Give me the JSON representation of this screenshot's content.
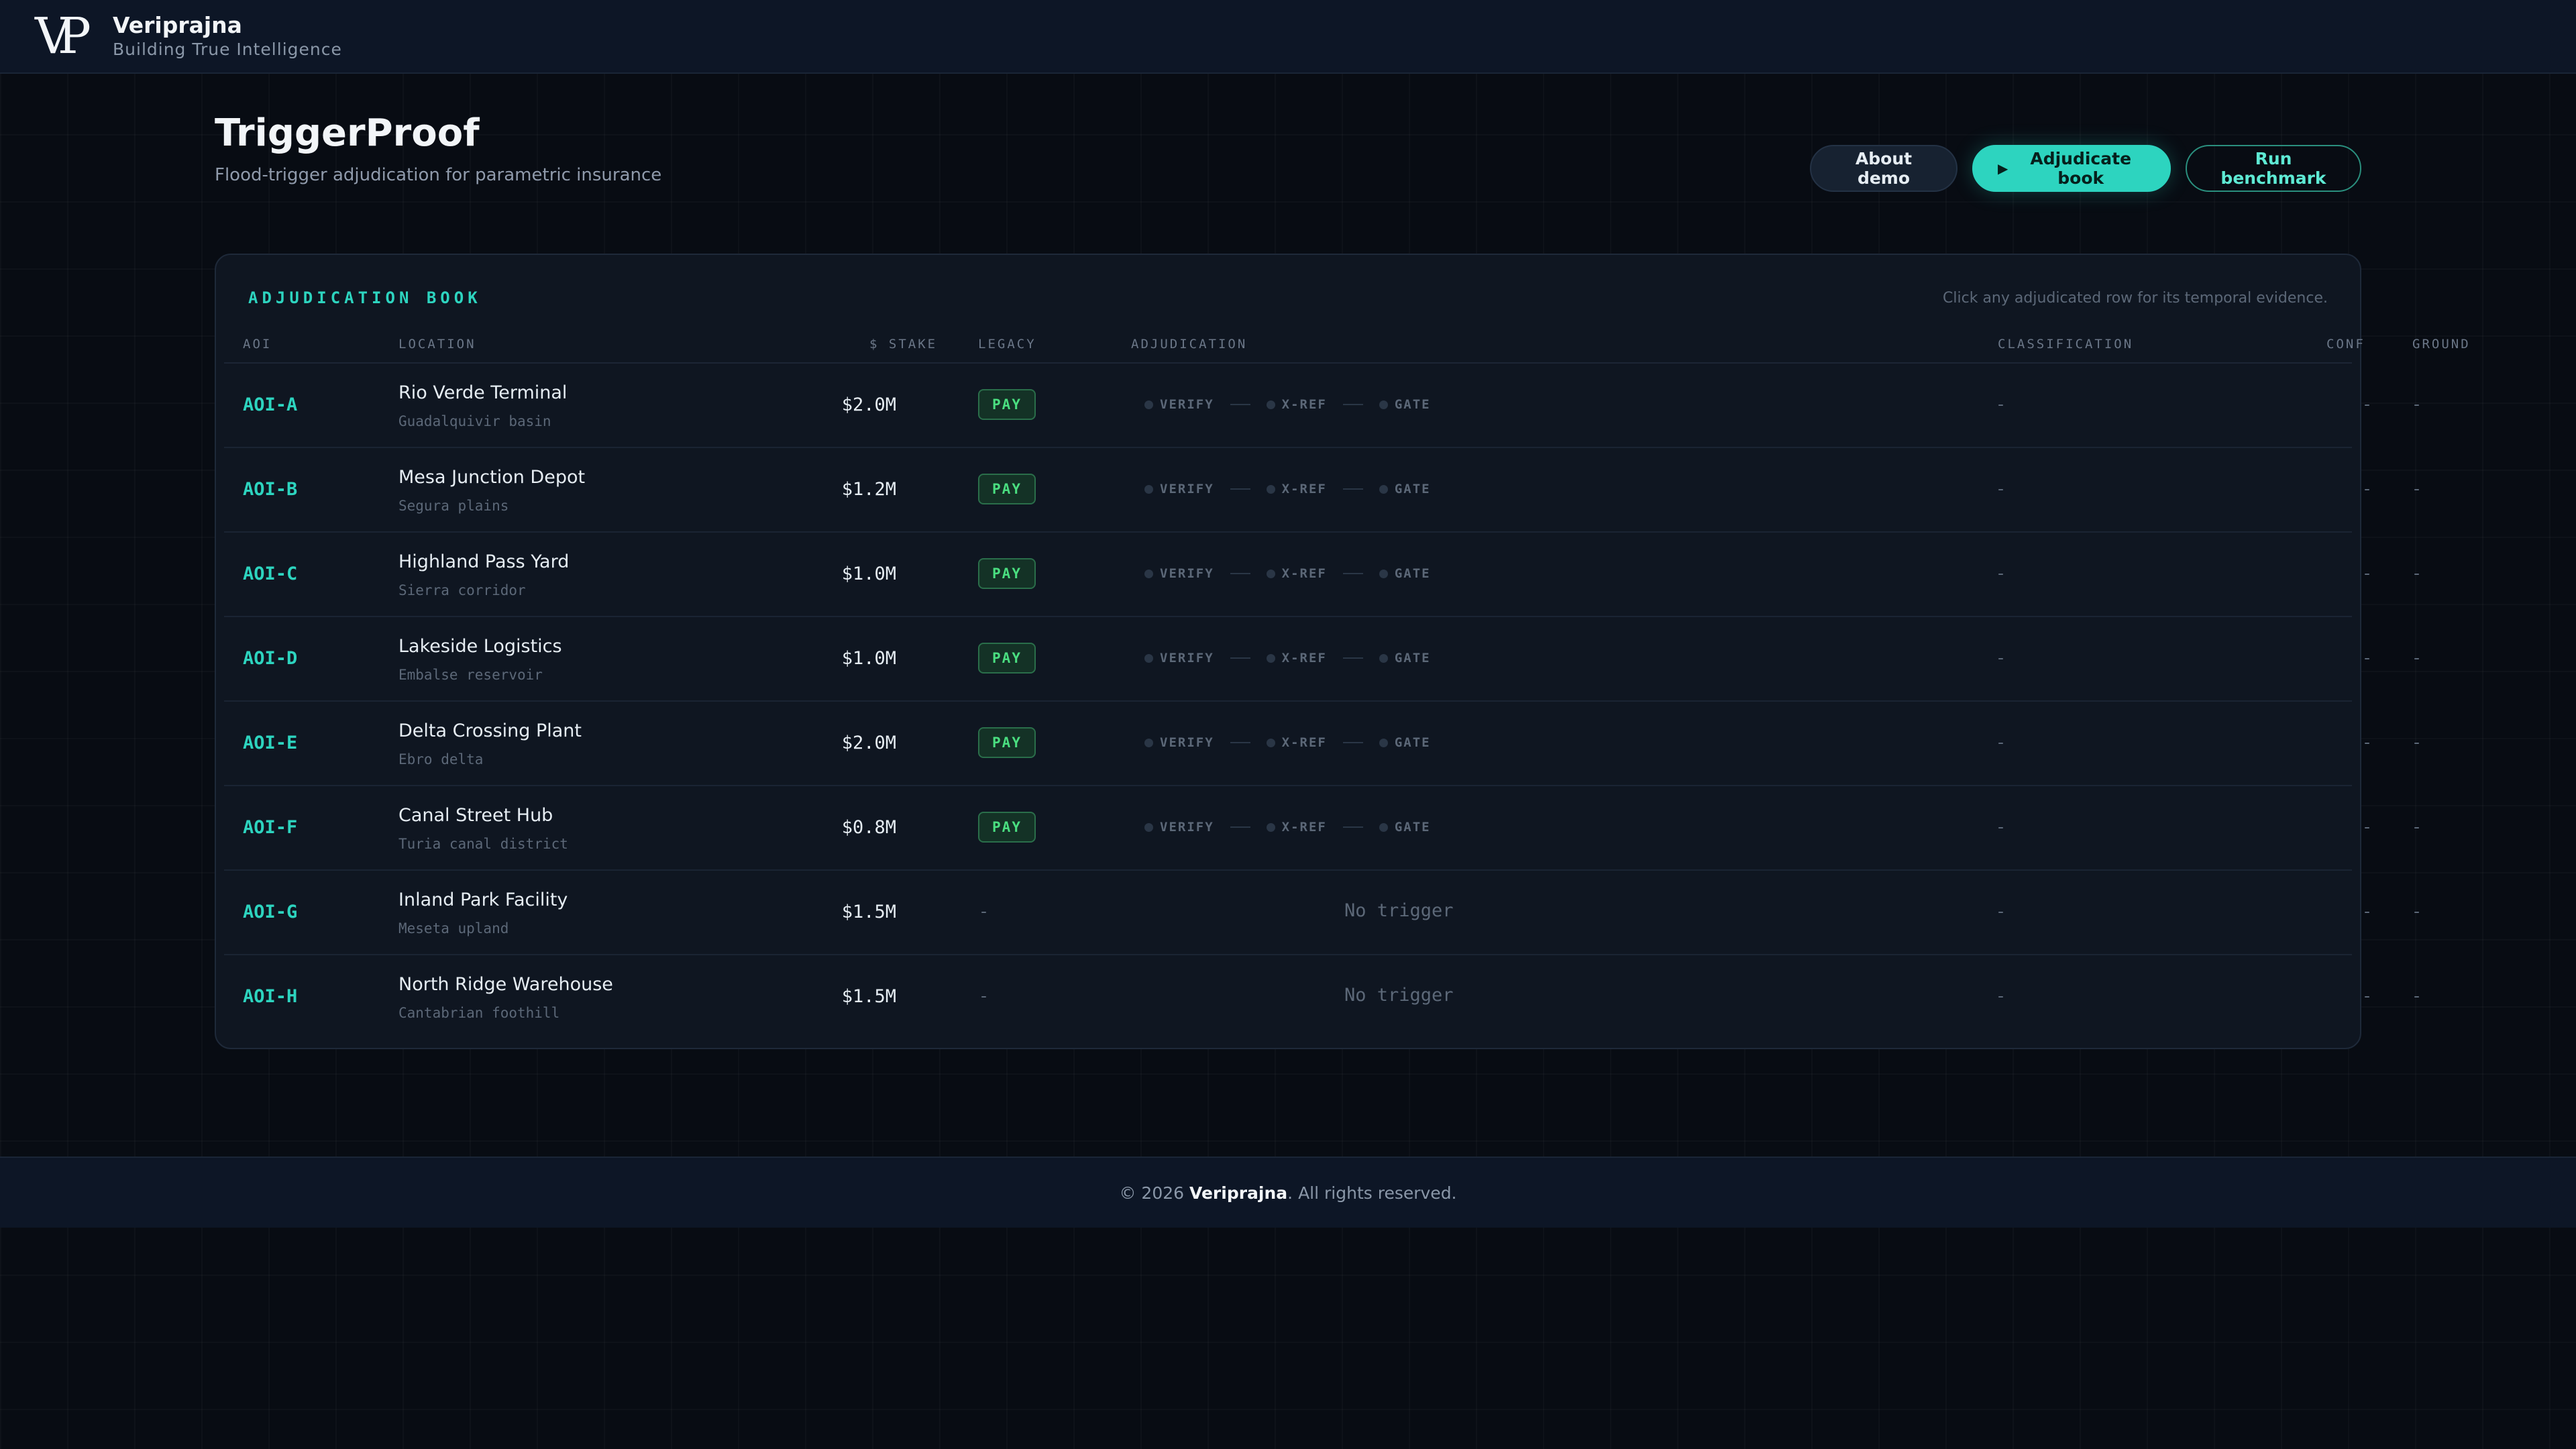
{
  "brand": {
    "logo_text": "VP",
    "name": "Veriprajna",
    "tagline": "Building True Intelligence"
  },
  "header": {
    "title": "TriggerProof",
    "subtitle": "Flood-trigger adjudication for parametric insurance",
    "buttons": {
      "about": "About demo",
      "adjudicate": "Adjudicate book",
      "adjudicate_icon": "play-icon",
      "benchmark": "Run benchmark"
    }
  },
  "panel": {
    "title": "ADJUDICATION BOOK",
    "hint": "Click any adjudicated row for its temporal evidence.",
    "columns": {
      "aoi": "AOI",
      "location": "LOCATION",
      "stake": "$ STAKE",
      "legacy": "LEGACY",
      "adjudication": "ADJUDICATION",
      "classification": "CLASSIFICATION",
      "conf": "CONF",
      "ground": "GROUND"
    },
    "steps": [
      "VERIFY",
      "X-REF",
      "GATE"
    ],
    "rows": [
      {
        "aoi": "AOI-A",
        "name": "Rio Verde Terminal",
        "region": "Guadalquivir basin",
        "stake": "$2.0M",
        "legacy": "PAY",
        "adjudication": "",
        "classification": "-",
        "conf": "-",
        "ground": "-"
      },
      {
        "aoi": "AOI-B",
        "name": "Mesa Junction Depot",
        "region": "Segura plains",
        "stake": "$1.2M",
        "legacy": "PAY",
        "adjudication": "",
        "classification": "-",
        "conf": "-",
        "ground": "-"
      },
      {
        "aoi": "AOI-C",
        "name": "Highland Pass Yard",
        "region": "Sierra corridor",
        "stake": "$1.0M",
        "legacy": "PAY",
        "adjudication": "",
        "classification": "-",
        "conf": "-",
        "ground": "-"
      },
      {
        "aoi": "AOI-D",
        "name": "Lakeside Logistics",
        "region": "Embalse reservoir",
        "stake": "$1.0M",
        "legacy": "PAY",
        "adjudication": "",
        "classification": "-",
        "conf": "-",
        "ground": "-"
      },
      {
        "aoi": "AOI-E",
        "name": "Delta Crossing Plant",
        "region": "Ebro delta",
        "stake": "$2.0M",
        "legacy": "PAY",
        "adjudication": "",
        "classification": "-",
        "conf": "-",
        "ground": "-"
      },
      {
        "aoi": "AOI-F",
        "name": "Canal Street Hub",
        "region": "Turia canal district",
        "stake": "$0.8M",
        "legacy": "PAY",
        "adjudication": "",
        "classification": "-",
        "conf": "-",
        "ground": "-"
      },
      {
        "aoi": "AOI-G",
        "name": "Inland Park Facility",
        "region": "Meseta upland",
        "stake": "$1.5M",
        "legacy": "-",
        "adjudication": "No trigger",
        "classification": "-",
        "conf": "-",
        "ground": "-"
      },
      {
        "aoi": "AOI-H",
        "name": "North Ridge Warehouse",
        "region": "Cantabrian foothill",
        "stake": "$1.5M",
        "legacy": "-",
        "adjudication": "No trigger",
        "classification": "-",
        "conf": "-",
        "ground": "-"
      }
    ]
  },
  "footer": {
    "prefix": "© 2026 ",
    "brand": "Veriprajna",
    "suffix": ". All rights reserved."
  },
  "colors": {
    "accent": "#2dd4bf",
    "pay_badge": "#4ade80",
    "background": "#080c13",
    "panel": "#0f1621"
  }
}
